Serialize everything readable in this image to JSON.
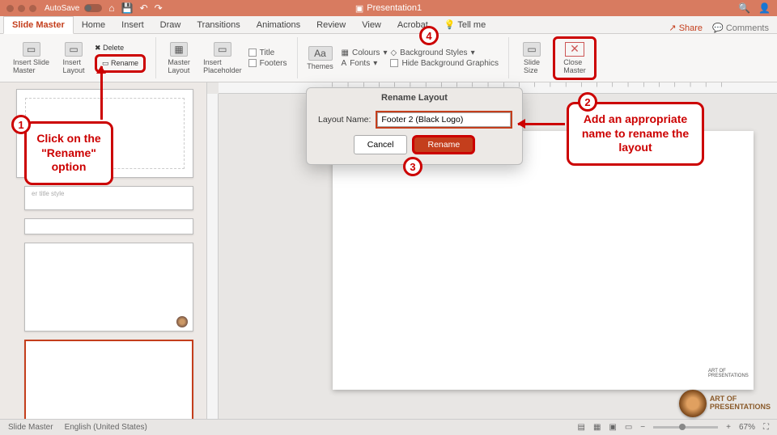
{
  "titlebar": {
    "autosave": "AutoSave",
    "title": "Presentation1"
  },
  "tabs": {
    "items": [
      "Slide Master",
      "Home",
      "Insert",
      "Draw",
      "Transitions",
      "Animations",
      "Review",
      "View",
      "Acrobat"
    ],
    "tellme": "Tell me",
    "share": "Share",
    "comments": "Comments"
  },
  "ribbon": {
    "insert_slide_master": "Insert Slide\nMaster",
    "insert_layout": "Insert\nLayout",
    "delete": "Delete",
    "rename": "Rename",
    "master_layout": "Master\nLayout",
    "insert_placeholder": "Insert\nPlaceholder",
    "title_cb": "Title",
    "footers_cb": "Footers",
    "themes": "Themes",
    "colours": "Colours",
    "fonts": "Fonts",
    "bg_styles": "Background Styles",
    "hide_bg": "Hide Background Graphics",
    "slide_size": "Slide\nSize",
    "close_master": "Close\nMaster"
  },
  "sidepanel": {
    "thumb2_text": "er title style"
  },
  "dialog": {
    "title": "Rename Layout",
    "label": "Layout Name:",
    "value": "Footer 2 (Black Logo)",
    "cancel": "Cancel",
    "rename": "Rename"
  },
  "status": {
    "mode": "Slide Master",
    "lang": "English (United States)",
    "zoom": "67%"
  },
  "annotations": {
    "c1": "Click on the\n\"Rename\"\noption",
    "c2": "Add an appropriate\nname to rename the\nlayout"
  },
  "watermark": "ART OF\nPRESENTATIONS",
  "slide_logo": "ART OF\nPRESENTATIONS"
}
